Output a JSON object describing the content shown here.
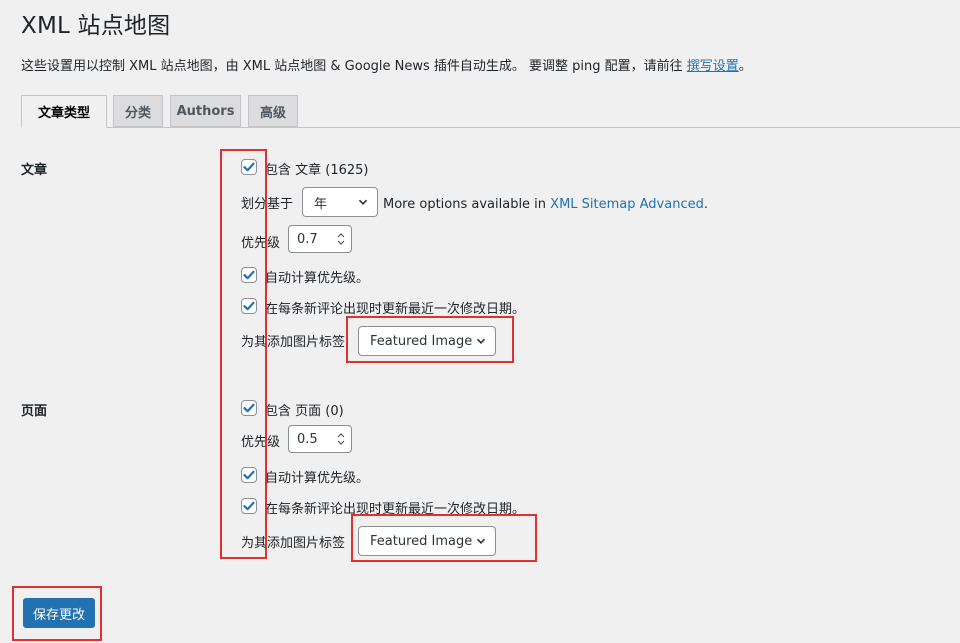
{
  "page": {
    "title": "XML 站点地图",
    "description_prefix": "这些设置用以控制 XML 站点地图，由 XML 站点地图 & Google News 插件自动生成。 要调整 ping 配置，请前往 ",
    "description_link": "撰写设置",
    "description_suffix": "。"
  },
  "tabs": [
    {
      "label": "文章类型",
      "active": true
    },
    {
      "label": "分类",
      "active": false
    },
    {
      "label": "Authors",
      "active": false
    },
    {
      "label": "高级",
      "active": false
    }
  ],
  "posts": {
    "heading": "文章",
    "include_label": "包含 文章 (1625)",
    "include_checked": true,
    "split_label": "划分基于",
    "split_value": "年",
    "more_options_text": "More options available in ",
    "more_options_link": "XML Sitemap Advanced",
    "more_options_end": ".",
    "priority_label": "优先级",
    "priority_value": "0.7",
    "auto_priority_label": "自动计算优先级。",
    "auto_priority_checked": true,
    "update_lastmod_label": "在每条新评论出现时更新最近一次修改日期。",
    "update_lastmod_checked": true,
    "image_tag_label": "为其添加图片标签",
    "image_tag_value": "Featured Image"
  },
  "pages": {
    "heading": "页面",
    "include_label": "包含 页面 (0)",
    "include_checked": true,
    "priority_label": "优先级",
    "priority_value": "0.5",
    "auto_priority_label": "自动计算优先级。",
    "auto_priority_checked": true,
    "update_lastmod_label": "在每条新评论出现时更新最近一次修改日期。",
    "update_lastmod_checked": true,
    "image_tag_label": "为其添加图片标签",
    "image_tag_value": "Featured Image"
  },
  "save_button": "保存更改",
  "colors": {
    "accent": "#2271b1",
    "highlight": "#e03131",
    "background": "#f0f0f1"
  }
}
